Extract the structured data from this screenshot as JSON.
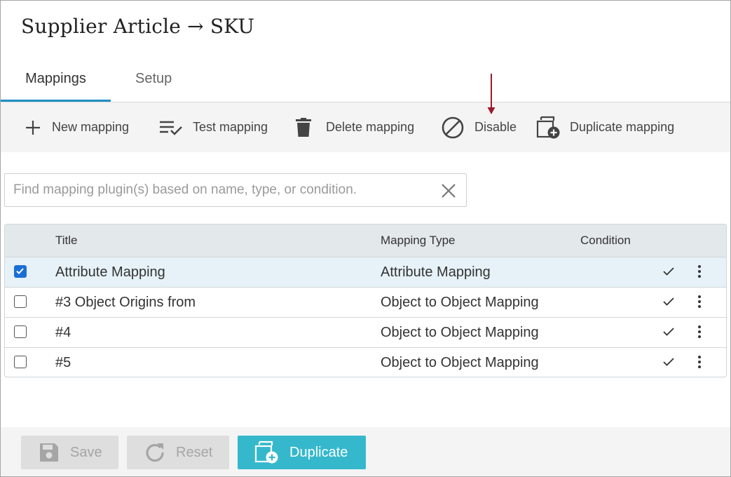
{
  "page": {
    "title": "Supplier Article → SKU"
  },
  "tabs": [
    {
      "label": "Mappings",
      "active": true
    },
    {
      "label": "Setup",
      "active": false
    }
  ],
  "toolbar": {
    "new_label": "New mapping",
    "test_label": "Test mapping",
    "delete_label": "Delete mapping",
    "disable_label": "Disable",
    "duplicate_label": "Duplicate mapping"
  },
  "search": {
    "placeholder": "Find mapping plugin(s) based on name, type, or condition.",
    "value": ""
  },
  "table": {
    "columns": {
      "title": "Title",
      "type": "Mapping Type",
      "condition": "Condition"
    },
    "rows": [
      {
        "title": "Attribute Mapping",
        "type": "Attribute Mapping",
        "checked": true
      },
      {
        "title": "#3 Object Origins from",
        "type": "Object to Object Mapping",
        "checked": false
      },
      {
        "title": "#4",
        "type": "Object to Object Mapping",
        "checked": false
      },
      {
        "title": "#5",
        "type": "Object to Object Mapping",
        "checked": false
      }
    ]
  },
  "footer": {
    "save_label": "Save",
    "reset_label": "Reset",
    "duplicate_label": "Duplicate"
  },
  "colors": {
    "accent": "#1f8fc4",
    "primary_button": "#35b8cc",
    "annotation_arrow": "#9b1b2a",
    "selected_row": "#e6f2f8",
    "checkbox_checked": "#1a6fd6"
  }
}
